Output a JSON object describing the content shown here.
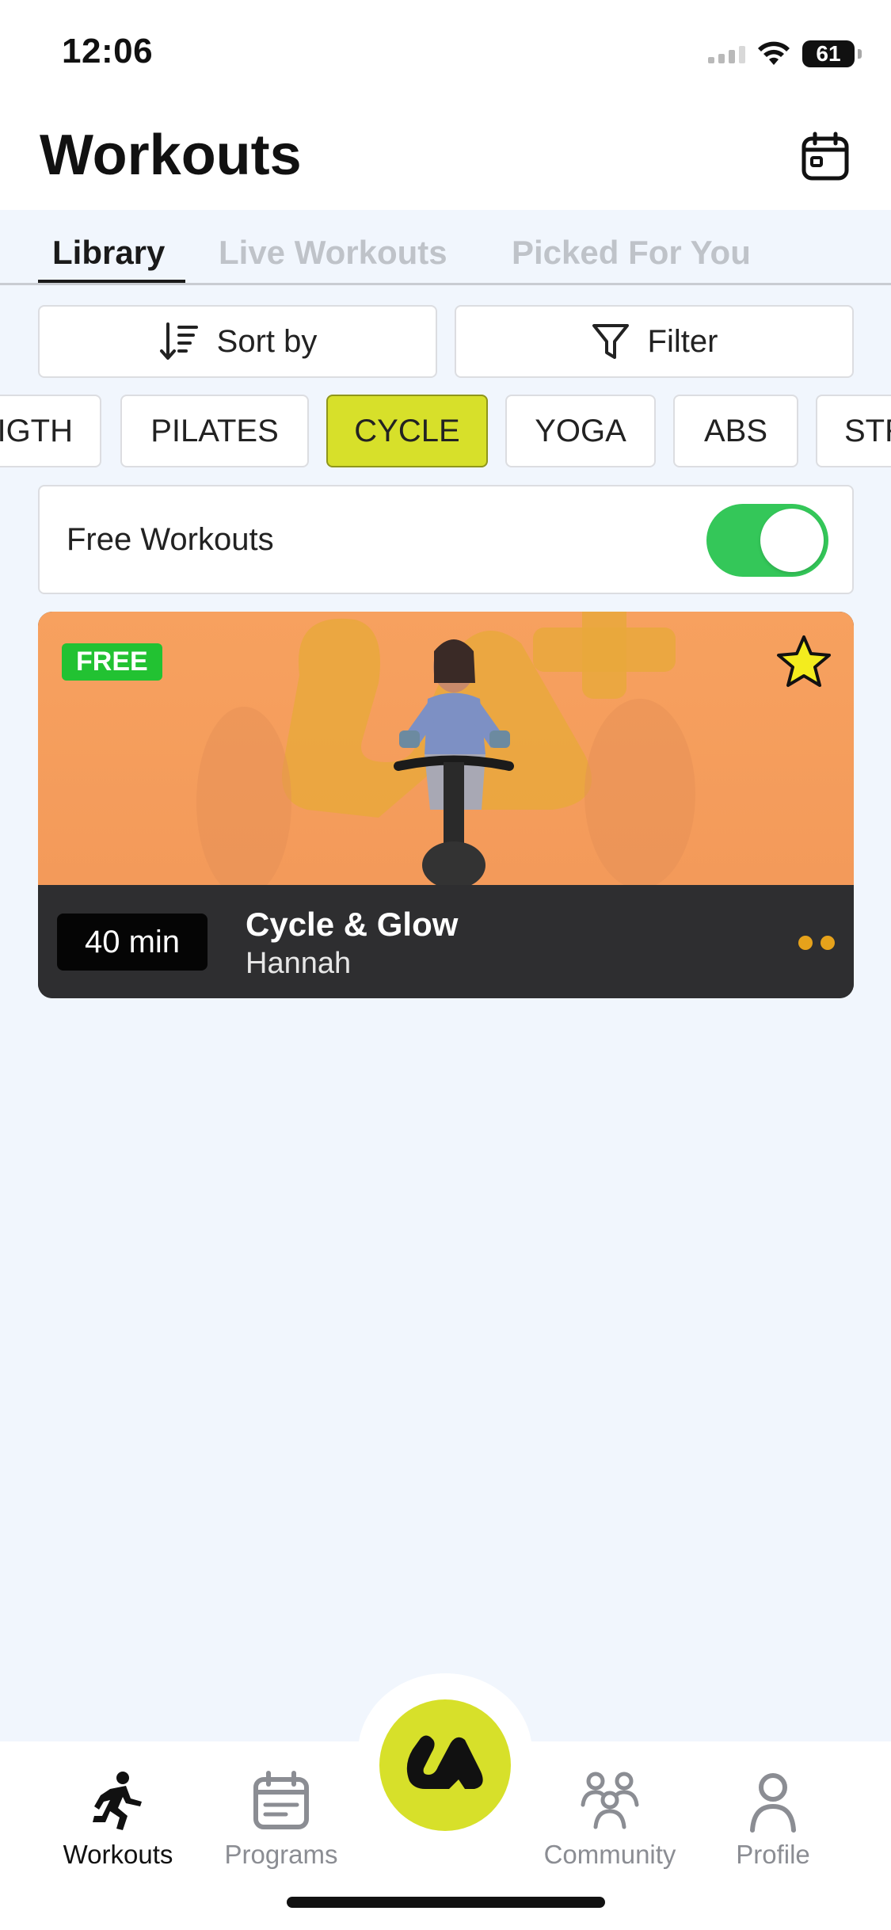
{
  "status_bar": {
    "time": "12:06",
    "battery": "61"
  },
  "header": {
    "title": "Workouts"
  },
  "tabs": [
    {
      "label": "Library",
      "active": true
    },
    {
      "label": "Live Workouts",
      "active": false
    },
    {
      "label": "Picked For You",
      "active": false
    }
  ],
  "toolbar": {
    "sort_label": "Sort by",
    "filter_label": "Filter"
  },
  "categories": [
    {
      "label": "STRENGTH",
      "visible_text": "IGTH",
      "active": false
    },
    {
      "label": "PILATES",
      "active": false
    },
    {
      "label": "CYCLE",
      "active": true
    },
    {
      "label": "YOGA",
      "active": false
    },
    {
      "label": "ABS",
      "active": false
    },
    {
      "label": "STR",
      "active": false
    }
  ],
  "free_toggle": {
    "label": "Free Workouts",
    "on": true
  },
  "workout": {
    "badge": "FREE",
    "duration": "40 min",
    "title": "Cycle & Glow",
    "coach": "Hannah",
    "favorite": true
  },
  "bottom_nav": {
    "items": [
      {
        "label": "Workouts",
        "icon": "running-icon",
        "active": true
      },
      {
        "label": "Programs",
        "icon": "calendar-icon",
        "active": false
      },
      {
        "label": "Community",
        "icon": "community-icon",
        "active": false
      },
      {
        "label": "Profile",
        "icon": "profile-icon",
        "active": false
      }
    ]
  },
  "colors": {
    "accent": "#d7e02a",
    "toggle_on": "#34c759",
    "badge_green": "#22c232",
    "thumbnail_orange": "#f39a5a",
    "card_dark": "#2e2e30"
  }
}
